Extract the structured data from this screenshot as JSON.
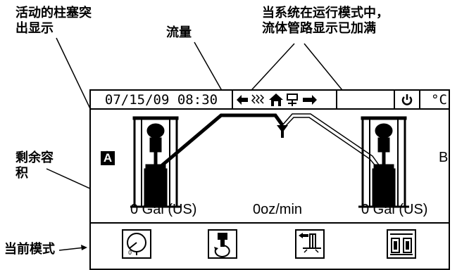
{
  "callouts": {
    "active_plunger": [
      "活动的柱塞突",
      "出显示"
    ],
    "flow": "流量",
    "run_mode": [
      "当系统在运行模式中，",
      "流体管路显示已加满"
    ],
    "remaining_volume": [
      "剩余容",
      "积"
    ],
    "current_mode": "当前模式"
  },
  "status_bar": {
    "datetime": "07/15/09 08:30",
    "power_icon": "power-icon",
    "unit": "°C"
  },
  "pumps": {
    "left_label": "A",
    "right_label": "B"
  },
  "readouts": {
    "left_volume": "0 Gal (US)",
    "flow_rate": "0oz/min",
    "right_volume": "0 Gal (US)"
  },
  "mode_icons": [
    "gauge-dial-icon",
    "pump-rotate-icon",
    "prime-pump-icon",
    "dual-pump-icon"
  ],
  "colors": {
    "foreground": "#000000",
    "background": "#ffffff"
  }
}
